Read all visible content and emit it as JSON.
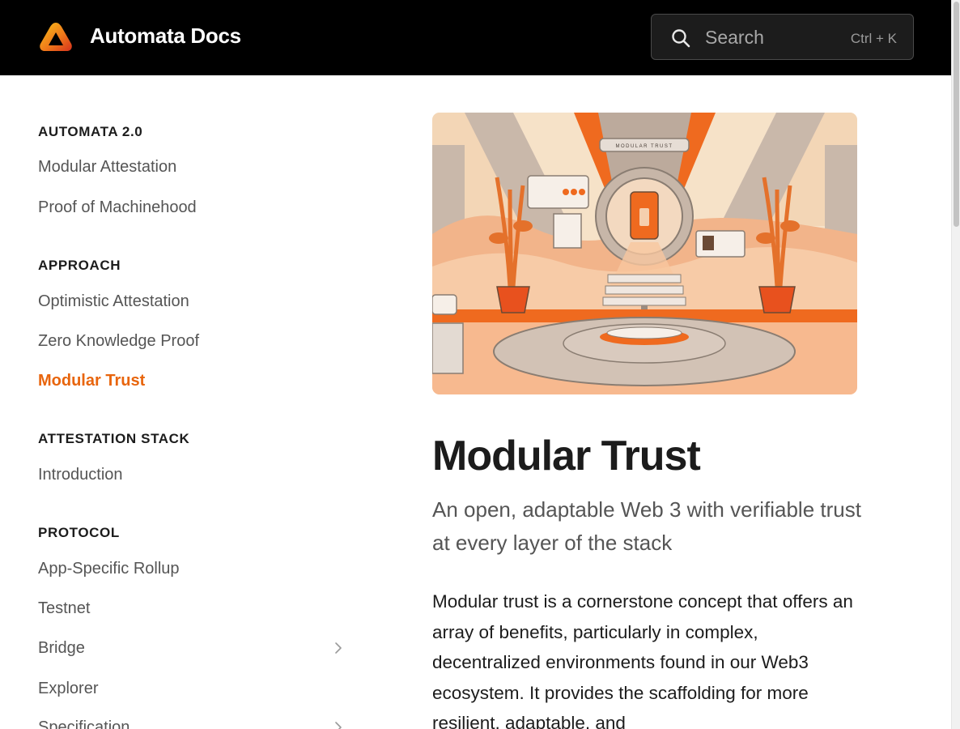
{
  "header": {
    "site_title": "Automata Docs",
    "search_placeholder": "Search",
    "search_shortcut": "Ctrl + K"
  },
  "sidebar": {
    "sections": [
      {
        "heading": "AUTOMATA 2.0",
        "items": [
          {
            "label": "Modular Attestation"
          },
          {
            "label": "Proof of Machinehood"
          }
        ]
      },
      {
        "heading": "APPROACH",
        "items": [
          {
            "label": "Optimistic Attestation"
          },
          {
            "label": "Zero Knowledge Proof"
          },
          {
            "label": "Modular Trust",
            "active": true
          }
        ]
      },
      {
        "heading": "ATTESTATION STACK",
        "items": [
          {
            "label": "Introduction"
          }
        ]
      },
      {
        "heading": "PROTOCOL",
        "items": [
          {
            "label": "App-Specific Rollup"
          },
          {
            "label": "Testnet"
          },
          {
            "label": "Bridge",
            "expandable": true
          },
          {
            "label": "Explorer"
          },
          {
            "label": "Specification",
            "expandable": true
          }
        ]
      }
    ]
  },
  "main": {
    "hero_sign_text": "MODULAR TRUST",
    "title": "Modular Trust",
    "subtitle": "An open, adaptable Web 3 with verifiable trust at every layer of the stack",
    "body": "Modular trust is a cornerstone concept that offers an array of benefits, particularly in complex, decentralized environments found in our Web3 ecosystem. It provides the scaffolding for more resilient, adaptable, and"
  },
  "colors": {
    "accent": "#e8650d",
    "header_bg": "#000000"
  },
  "icons": {
    "logo": "automata-logo-icon",
    "search": "search-icon",
    "chevron": "chevron-right-icon"
  }
}
